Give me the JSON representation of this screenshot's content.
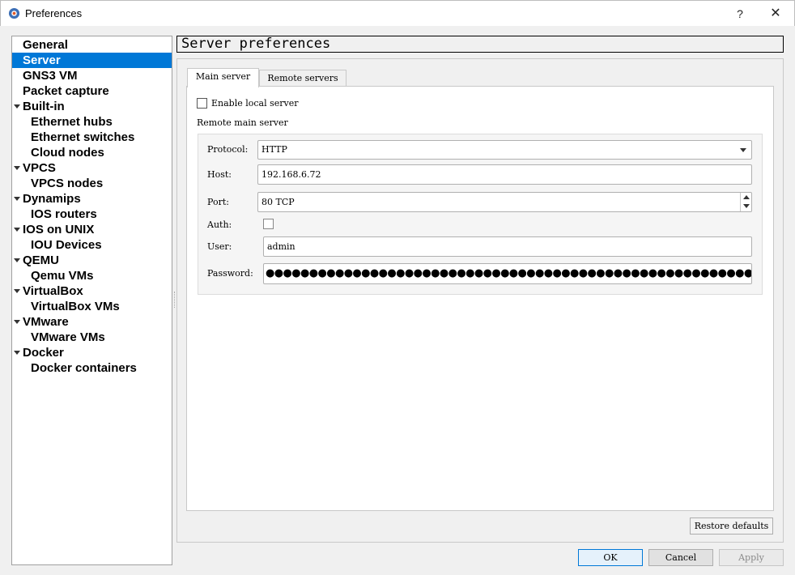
{
  "window": {
    "title": "Preferences",
    "help_label": "?",
    "close_label": "✕"
  },
  "sidebar": {
    "items": [
      {
        "label": "General",
        "level": 0,
        "expandable": false,
        "selected": false
      },
      {
        "label": "Server",
        "level": 0,
        "expandable": false,
        "selected": true
      },
      {
        "label": "GNS3 VM",
        "level": 0,
        "expandable": false,
        "selected": false
      },
      {
        "label": "Packet capture",
        "level": 0,
        "expandable": false,
        "selected": false
      },
      {
        "label": "Built-in",
        "level": 0,
        "expandable": true,
        "selected": false
      },
      {
        "label": "Ethernet hubs",
        "level": 1,
        "expandable": false,
        "selected": false
      },
      {
        "label": "Ethernet switches",
        "level": 1,
        "expandable": false,
        "selected": false
      },
      {
        "label": "Cloud nodes",
        "level": 1,
        "expandable": false,
        "selected": false
      },
      {
        "label": "VPCS",
        "level": 0,
        "expandable": true,
        "selected": false
      },
      {
        "label": "VPCS nodes",
        "level": 1,
        "expandable": false,
        "selected": false
      },
      {
        "label": "Dynamips",
        "level": 0,
        "expandable": true,
        "selected": false
      },
      {
        "label": "IOS routers",
        "level": 1,
        "expandable": false,
        "selected": false
      },
      {
        "label": "IOS on UNIX",
        "level": 0,
        "expandable": true,
        "selected": false
      },
      {
        "label": "IOU Devices",
        "level": 1,
        "expandable": false,
        "selected": false
      },
      {
        "label": "QEMU",
        "level": 0,
        "expandable": true,
        "selected": false
      },
      {
        "label": "Qemu VMs",
        "level": 1,
        "expandable": false,
        "selected": false
      },
      {
        "label": "VirtualBox",
        "level": 0,
        "expandable": true,
        "selected": false
      },
      {
        "label": "VirtualBox VMs",
        "level": 1,
        "expandable": false,
        "selected": false
      },
      {
        "label": "VMware",
        "level": 0,
        "expandable": true,
        "selected": false
      },
      {
        "label": "VMware VMs",
        "level": 1,
        "expandable": false,
        "selected": false
      },
      {
        "label": "Docker",
        "level": 0,
        "expandable": true,
        "selected": false
      },
      {
        "label": "Docker containers",
        "level": 1,
        "expandable": false,
        "selected": false
      }
    ]
  },
  "header": {
    "title": "Server preferences"
  },
  "tabs": [
    {
      "label": "Main server",
      "active": true
    },
    {
      "label": "Remote servers",
      "active": false
    }
  ],
  "main_server": {
    "enable_local_label": "Enable local server",
    "enable_local_checked": false,
    "remote_group_label": "Remote main server",
    "protocol_label": "Protocol:",
    "protocol_value": "HTTP",
    "host_label": "Host:",
    "host_value": "192.168.6.72",
    "port_label": "Port:",
    "port_value": "80 TCP",
    "auth_label": "Auth:",
    "auth_checked": false,
    "user_label": "User:",
    "user_value": "admin",
    "password_label": "Password:",
    "password_masked": "●●●●●●●●●●●●●●●●●●●●●●●●●●●●●●●●●●●●●●●●●●●●●●●●●●●●●●●●●●●●"
  },
  "buttons": {
    "restore_defaults": "Restore defaults",
    "ok": "OK",
    "cancel": "Cancel",
    "apply": "Apply"
  },
  "colors": {
    "selection": "#0078d7",
    "window_bg": "#f0f0f0"
  }
}
